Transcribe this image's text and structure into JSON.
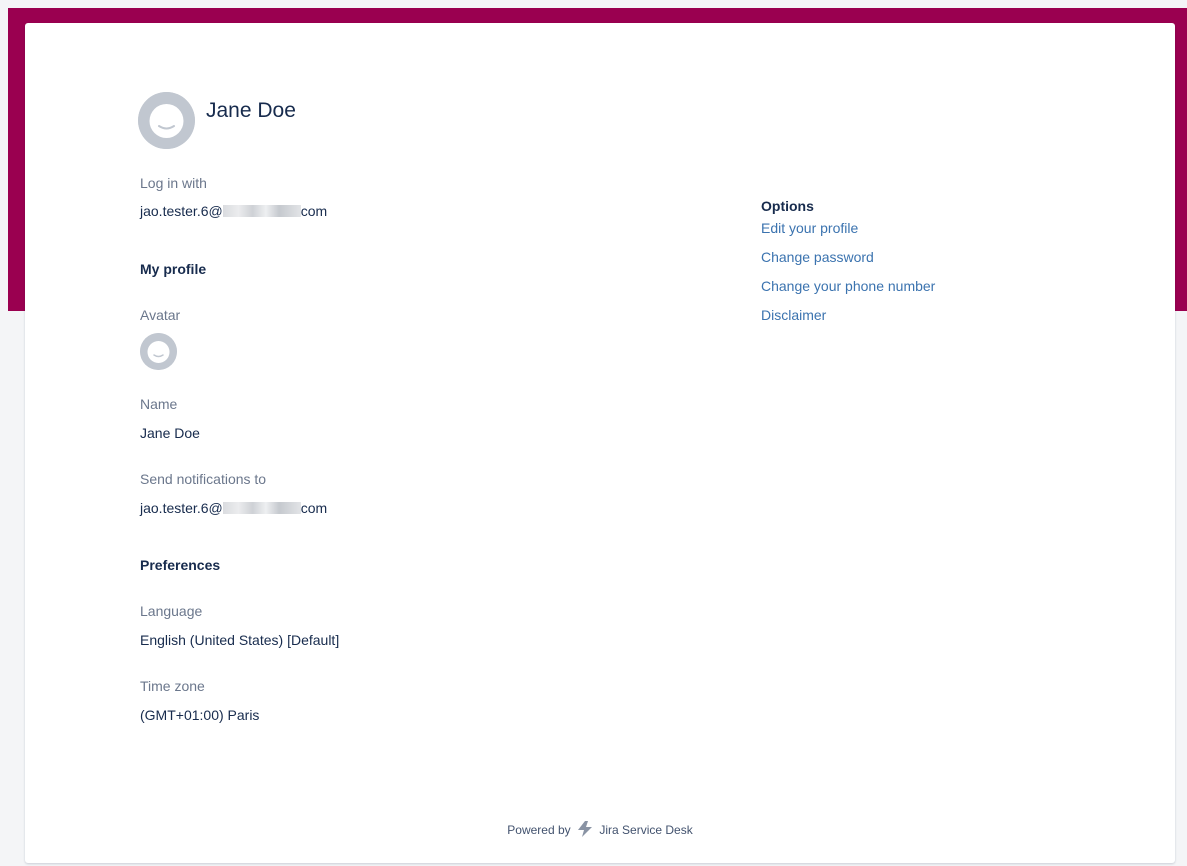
{
  "profile": {
    "display_name": "Jane Doe",
    "login": {
      "label": "Log in with",
      "email_prefix": "jao.tester.6@",
      "email_suffix": "com"
    }
  },
  "my_profile": {
    "heading": "My profile",
    "avatar_label": "Avatar",
    "name_label": "Name",
    "name_value": "Jane Doe",
    "notifications_label": "Send notifications to",
    "notifications_prefix": "jao.tester.6@",
    "notifications_suffix": "com"
  },
  "preferences": {
    "heading": "Preferences",
    "language_label": "Language",
    "language_value": "English (United States) [Default]",
    "timezone_label": "Time zone",
    "timezone_value": "(GMT+01:00) Paris"
  },
  "options": {
    "heading": "Options",
    "links": [
      {
        "label": "Edit your profile"
      },
      {
        "label": "Change password"
      },
      {
        "label": "Change your phone number"
      },
      {
        "label": "Disclaimer"
      }
    ]
  },
  "footer": {
    "prefix": "Powered by",
    "product": "Jira Service Desk"
  },
  "colors": {
    "banner": "#9a0050",
    "link": "#3b73af",
    "label": "#6b778c",
    "text": "#172b4d",
    "background": "#f4f5f7"
  }
}
